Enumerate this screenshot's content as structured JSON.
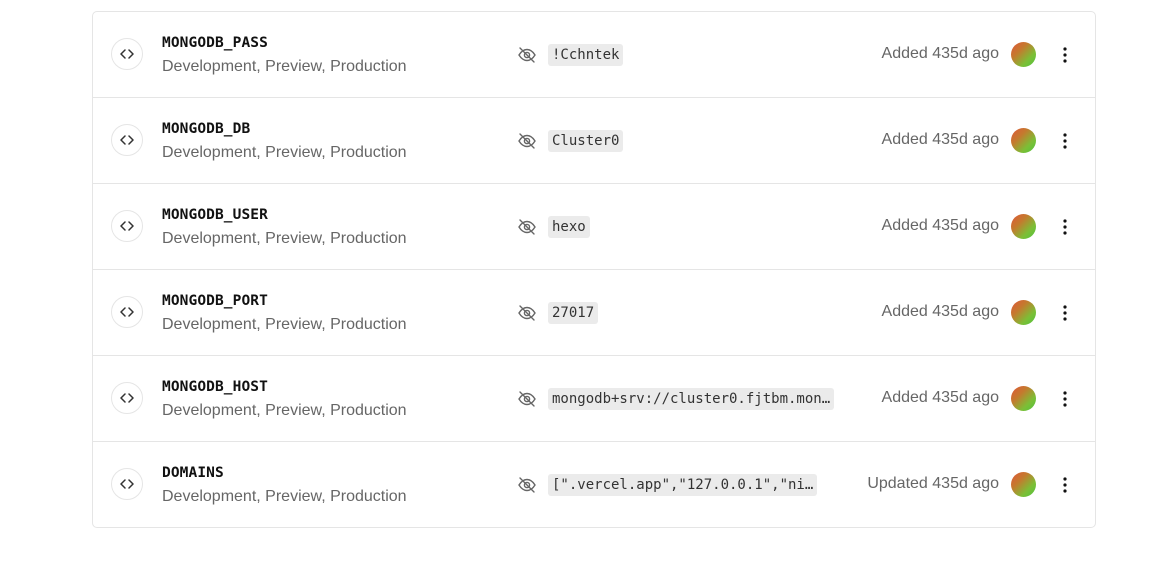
{
  "variables": [
    {
      "key": "MONGODB_PASS",
      "environments": "Development, Preview, Production",
      "value": "!Cchntek",
      "status": "Added 435d ago"
    },
    {
      "key": "MONGODB_DB",
      "environments": "Development, Preview, Production",
      "value": "Cluster0",
      "status": "Added 435d ago"
    },
    {
      "key": "MONGODB_USER",
      "environments": "Development, Preview, Production",
      "value": "hexo",
      "status": "Added 435d ago"
    },
    {
      "key": "MONGODB_PORT",
      "environments": "Development, Preview, Production",
      "value": "27017",
      "status": "Added 435d ago"
    },
    {
      "key": "MONGODB_HOST",
      "environments": "Development, Preview, Production",
      "value": "mongodb+srv://cluster0.fjtbm.mon…",
      "status": "Added 435d ago"
    },
    {
      "key": "DOMAINS",
      "environments": "Development, Preview, Production",
      "value": "[\".vercel.app\",\"127.0.0.1\",\"ni…",
      "status": "Updated 435d ago"
    }
  ],
  "icons": {
    "type": "code-icon",
    "visibility": "eye-off-icon",
    "menu": "more-vertical-icon"
  },
  "colors": {
    "border": "#e5e5e5",
    "muted_text": "#666666",
    "chip_bg": "#ebebeb",
    "avatar_gradient": [
      "#e0563a",
      "#4fc23f"
    ]
  }
}
